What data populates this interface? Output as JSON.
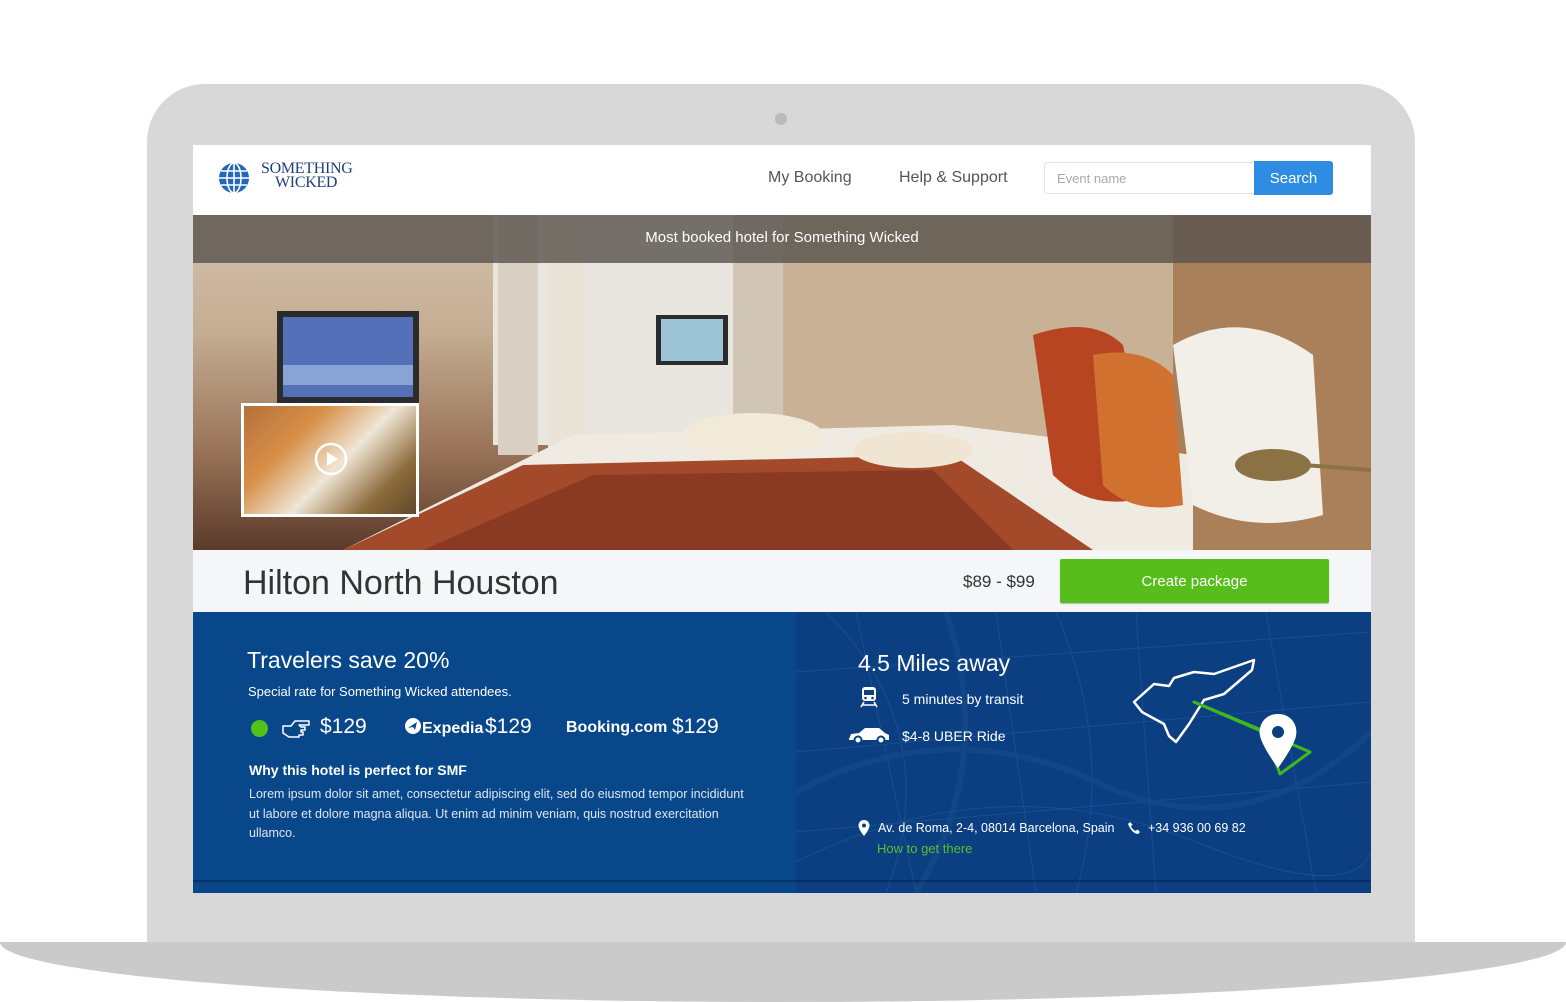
{
  "header": {
    "logo_line1": "SOMETHING",
    "logo_line2": "WICKED",
    "nav": [
      "My Booking",
      "Help & Support"
    ],
    "search_placeholder": "Event name",
    "search_label": "Search"
  },
  "hero": {
    "banner": "Most booked hotel for Something Wicked"
  },
  "hotel": {
    "name": "Hilton North Houston",
    "price_range": "$89 - $99",
    "create_label": "Create package"
  },
  "offer": {
    "title": "Travelers save 20%",
    "subtitle": "Special rate for Something Wicked attendees.",
    "rates": [
      {
        "source": "direct",
        "price": "$129"
      },
      {
        "source": "Expedia",
        "price": "$129"
      },
      {
        "source": "Booking.com",
        "price": "$129"
      }
    ],
    "why_title": "Why this hotel is perfect for SMF",
    "why_body": "Lorem ipsum dolor sit amet, consectetur adipiscing elit, sed do eiusmod tempor incididunt ut labore et dolore magna aliqua.  Ut enim ad minim veniam, quis nostrud exercitation ullamco."
  },
  "location": {
    "distance": "4.5 Miles away",
    "transit": "5 minutes by transit",
    "uber": "$4-8 UBER Ride",
    "address": "Av. de Roma, 2-4, 08014 Barcelona, Spain",
    "phone": "+34 936 00 69 82",
    "how_link": "How to get there"
  },
  "colors": {
    "brand_blue": "#08488a",
    "search_button": "#2e8ce3",
    "create_button": "#56bd1a",
    "rate_dot": "#51c21a",
    "link_green": "#5bc02a"
  },
  "icons": [
    "globe-icon",
    "play-icon",
    "pointing-hand-icon",
    "train-icon",
    "car-icon",
    "map-pin-icon",
    "phone-icon"
  ]
}
